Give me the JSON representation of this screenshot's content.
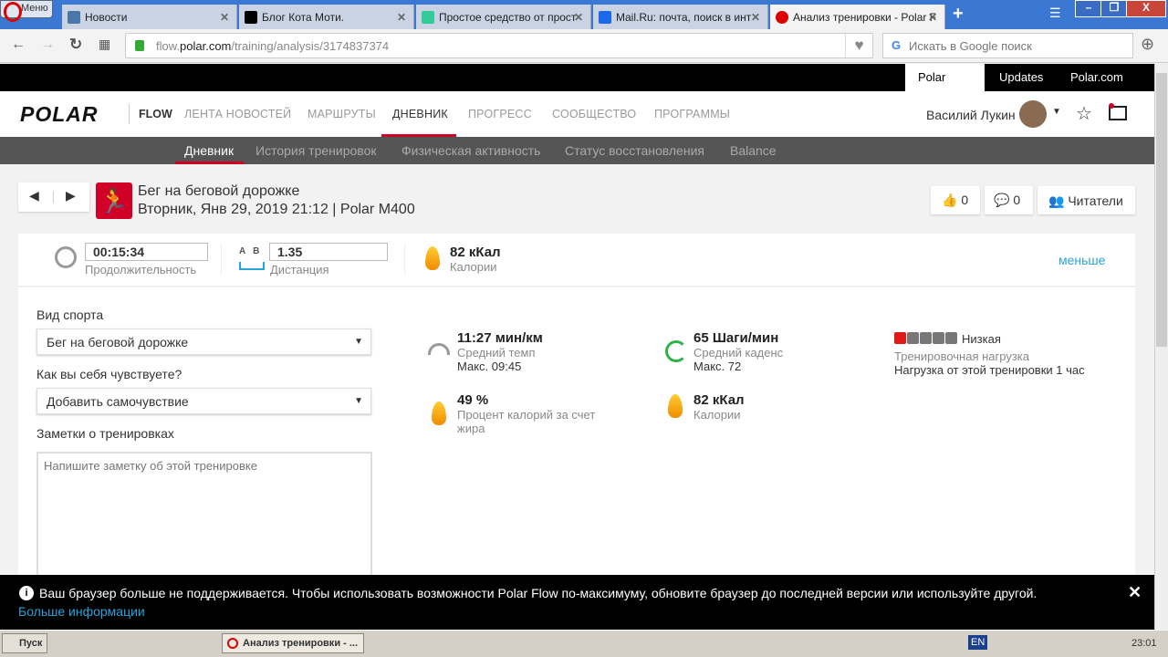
{
  "browser": {
    "menu": "Меню",
    "tabs": [
      {
        "label": "Новости",
        "color": "#4a76a8"
      },
      {
        "label": "Блог Кота Моти.",
        "color": "#000"
      },
      {
        "label": "Простое средство от прост",
        "color": "#3c9"
      },
      {
        "label": "Mail.Ru: почта, поиск в инт",
        "color": "#1a6ae8"
      },
      {
        "label": "Анализ тренировки - Polar F",
        "color": "#d00"
      }
    ],
    "url_host": "flow.",
    "url_domain": "polar.com",
    "url_path": "/training/analysis/3174837374",
    "search_placeholder": "Искать в Google поиск"
  },
  "topnav": [
    "Polar Flow",
    "Updates",
    "Polar.com"
  ],
  "header": {
    "logo": "POLAR",
    "flow": "FLOW",
    "nav": [
      "ЛЕНТА НОВОСТЕЙ",
      "МАРШРУТЫ",
      "ДНЕВНИК",
      "ПРОГРЕСС",
      "СООБЩЕСТВО",
      "ПРОГРАММЫ"
    ],
    "active": "ДНЕВНИК",
    "user": "Василий Лукин"
  },
  "subnav": [
    "Дневник",
    "История тренировок",
    "Физическая активность",
    "Статус восстановления",
    "Balance"
  ],
  "training": {
    "sport": "Бег на беговой дорожке",
    "date": "Вторник, Янв 29, 2019 21:12 | Polar M400",
    "likes": "0",
    "comments": "0",
    "readers": "Читатели"
  },
  "summary": {
    "duration": "00:15:34",
    "duration_label": "Продолжительность",
    "ab": "A   B",
    "distance": "1.35",
    "distance_label": "Дистанция",
    "calories": "82 кКал",
    "calories_label": "Калории",
    "less": "меньше"
  },
  "form": {
    "sport_label": "Вид спорта",
    "sport_value": "Бег на беговой дорожке",
    "feel_label": "Как вы себя чувствуете?",
    "feel_value": "Добавить самочувствие",
    "notes_label": "Заметки о тренировках",
    "notes_placeholder": "Напишите заметку об этой тренировке"
  },
  "stats": {
    "pace": "11:27 мин/км",
    "pace_label": "Средний темп",
    "pace_max": "Макс. 09:45",
    "cadence": "65 Шаги/мин",
    "cadence_label": "Средний каденс",
    "cadence_max": "Макс. 72",
    "fat": "49 %",
    "fat_label": "Процент калорий за счет жира",
    "cal": "82 кКал",
    "cal_label": "Калории",
    "load_level": "Низкая",
    "load_level_value": 1,
    "load_level_max": 5,
    "load_label": "Тренировочная нагрузка",
    "load_text": "Нагрузка от этой тренировки 1 час"
  },
  "notice": {
    "text": "Ваш браузер больше не поддерживается. Чтобы использовать возможности Polar Flow по-максимуму, обновите браузер до последней версии или используйте другой.",
    "link": "Больше информации"
  },
  "taskbar": {
    "start": "Пуск",
    "window": "Анализ тренировки - ...",
    "lang": "EN",
    "time": "23:01"
  }
}
